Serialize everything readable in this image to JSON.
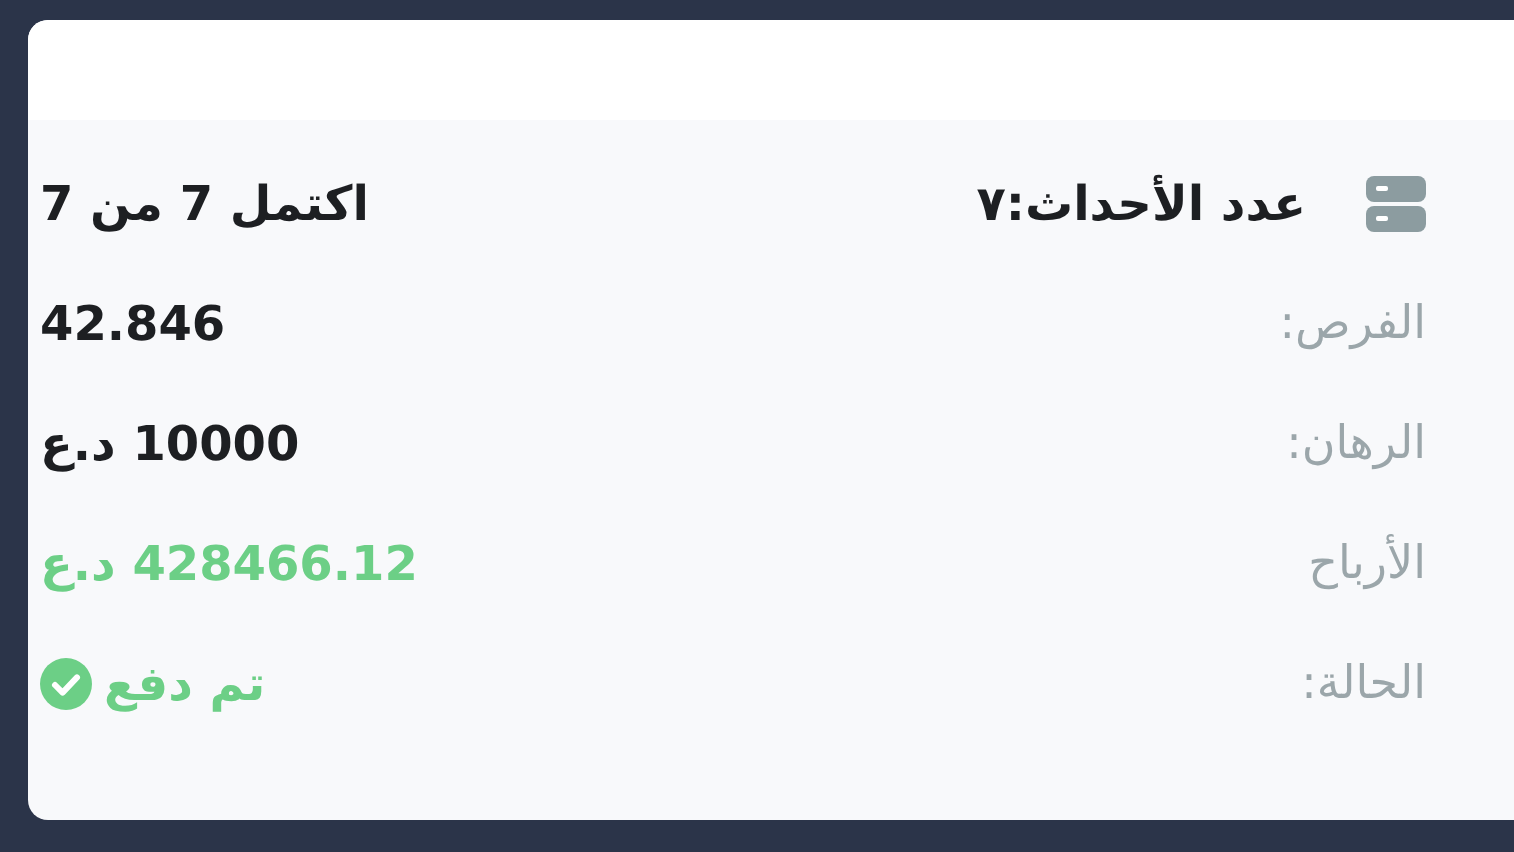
{
  "header": {
    "title": "عدد الأحداث:٧",
    "progress": "اكتمل 7 من 7"
  },
  "rows": [
    {
      "label": "الفرص:",
      "value": "42.846",
      "kind": "plain"
    },
    {
      "label": "الرهان:",
      "value": "10000 د.ع",
      "kind": "plain"
    },
    {
      "label": "الأرباح",
      "value": "428466.12 د.ع",
      "kind": "gain"
    },
    {
      "label": "الحالة:",
      "value": "تم دفع",
      "kind": "status"
    }
  ]
}
